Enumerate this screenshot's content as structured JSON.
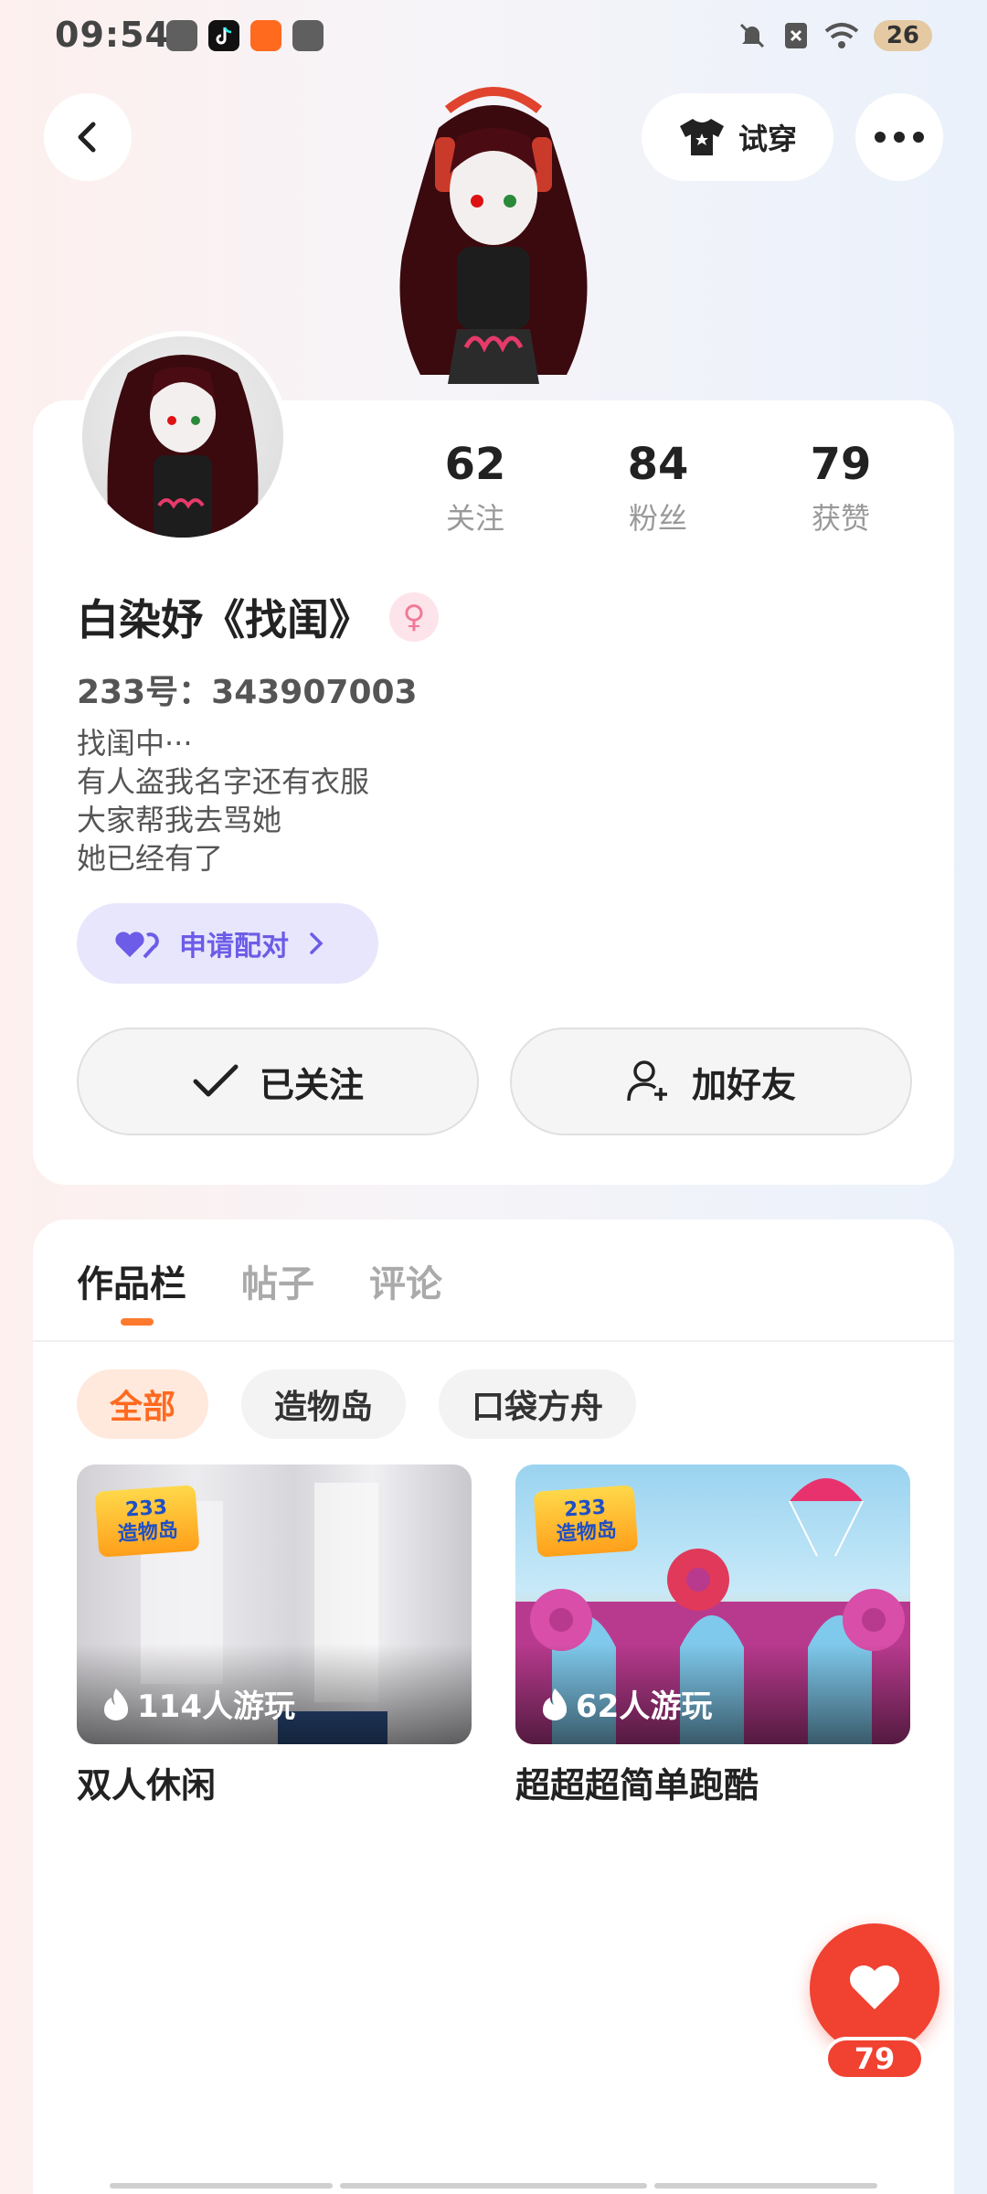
{
  "status_bar": {
    "time": "09:54",
    "battery": "26"
  },
  "header": {
    "tryon_label": "试穿"
  },
  "profile": {
    "stats": [
      {
        "value": "62",
        "label": "关注"
      },
      {
        "value": "84",
        "label": "粉丝"
      },
      {
        "value": "79",
        "label": "获赞"
      }
    ],
    "nickname": "白染妤《找闺》",
    "gender_symbol": "♀",
    "uid": "233号：343907003",
    "bio": [
      "找闺中···",
      "有人盗我名字还有衣服",
      "大家帮我去骂她",
      "她已经有了"
    ],
    "pair_label": "申请配对",
    "follow_label": "已关注",
    "add_friend_label": "加好友"
  },
  "works": {
    "tabs": [
      "作品栏",
      "帖子",
      "评论"
    ],
    "active_tab": "作品栏",
    "chips": [
      "全部",
      "造物岛",
      "口袋方舟"
    ],
    "active_chip": "全部",
    "games": [
      {
        "logo_top": "233",
        "logo_bottom": "造物岛",
        "players": "114人游玩",
        "title": "双人休闲"
      },
      {
        "logo_top": "233",
        "logo_bottom": "造物岛",
        "players": "62人游玩",
        "title": "超超超简单跑酷"
      }
    ]
  },
  "like_fab": {
    "count": "79"
  },
  "colors": {
    "accent": "#ff7a2f",
    "like": "#f04131",
    "pair": "#6c5ce7",
    "gender": "#f07a98"
  }
}
